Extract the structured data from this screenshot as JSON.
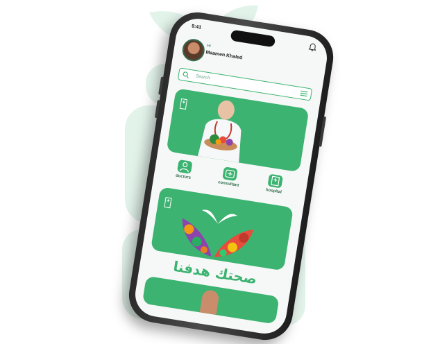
{
  "status_bar": {
    "time": "9:41"
  },
  "header": {
    "greeting": "Hi",
    "user_name": "Maamen Khaled"
  },
  "search": {
    "placeholder": "Search"
  },
  "categories": [
    {
      "label": "doctors",
      "icon": "doctor-icon"
    },
    {
      "label": "consultant",
      "icon": "consultant-icon"
    },
    {
      "label": "hospital",
      "icon": "hospital-icon"
    }
  ],
  "slogan": "صحتك هدفنا",
  "colors": {
    "accent": "#3cb371",
    "background_leaf": "#d9f0e3",
    "frame": "#2b2b2b"
  }
}
